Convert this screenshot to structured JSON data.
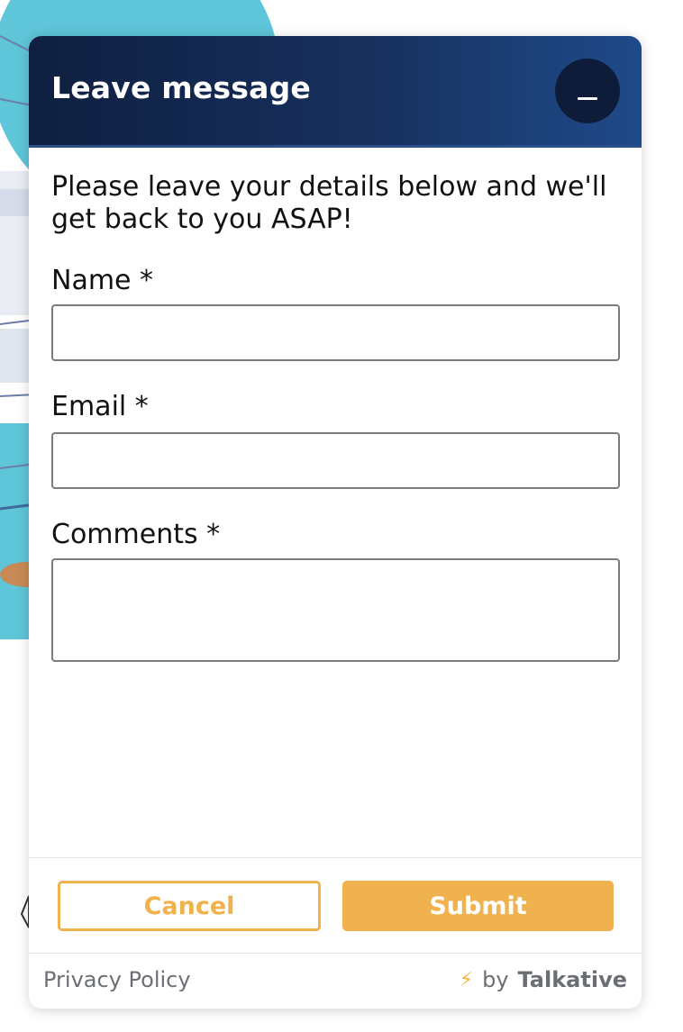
{
  "widget": {
    "title": "Leave message",
    "intro": "Please leave your details below and we'll get back to you ASAP!",
    "fields": {
      "name": {
        "label": "Name *",
        "value": ""
      },
      "email": {
        "label": "Email *",
        "value": ""
      },
      "comments": {
        "label": "Comments *",
        "value": ""
      }
    },
    "buttons": {
      "cancel": "Cancel",
      "submit": "Submit"
    },
    "footer": {
      "privacy": "Privacy Policy",
      "by": "by",
      "brand": "Talkative",
      "bolt_icon": "bolt-icon"
    }
  },
  "colors": {
    "header_start": "#0f1f41",
    "header_end": "#1f4a8a",
    "accent": "#efb24f",
    "text": "#111111",
    "muted": "#6b6f75"
  }
}
